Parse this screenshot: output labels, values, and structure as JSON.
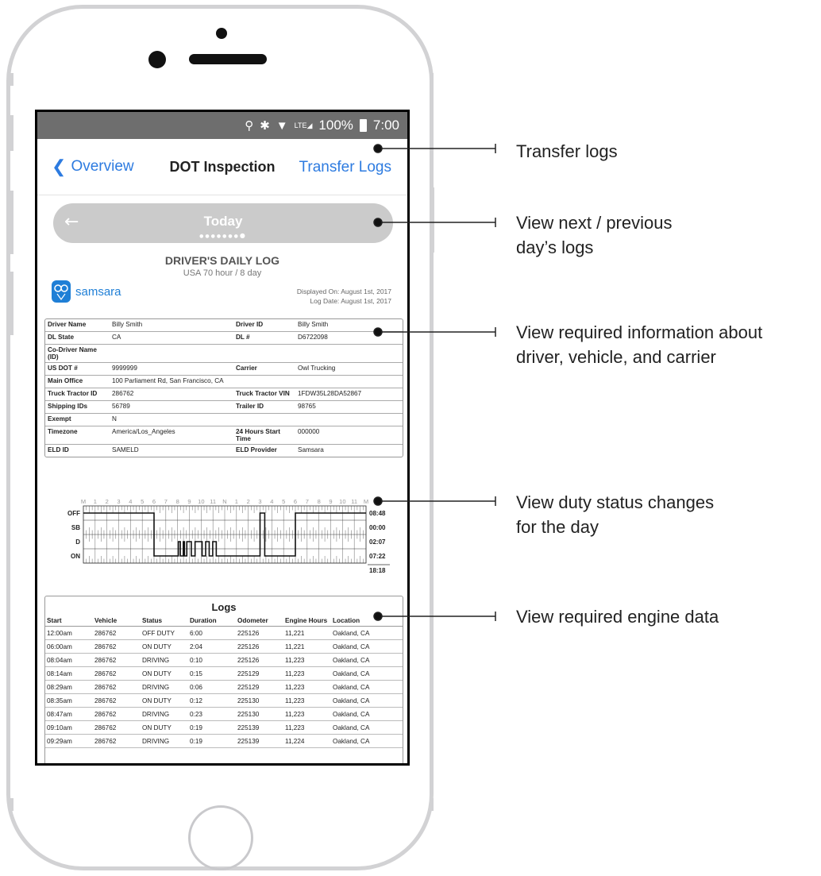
{
  "status_bar": {
    "battery": "100%",
    "time": "7:00",
    "network": "LTE"
  },
  "nav": {
    "back_label": "Overview",
    "title": "DOT Inspection",
    "action_label": "Transfer Logs"
  },
  "day_nav": {
    "label": "Today"
  },
  "report": {
    "title": "DRIVER'S DAILY LOG",
    "subtitle": "USA 70 hour / 8 day",
    "brand": "samsara",
    "displayed_on": "Displayed On: August 1st, 2017",
    "log_date": "Log Date: August 1st, 2017"
  },
  "info": {
    "driver_name_k": "Driver Name",
    "driver_name_v": "Billy Smith",
    "driver_id_k": "Driver ID",
    "driver_id_v": "Billy Smith",
    "dl_state_k": "DL State",
    "dl_state_v": "CA",
    "dl_num_k": "DL #",
    "dl_num_v": "D6722098",
    "codriver_k": "Co-Driver Name (ID)",
    "usdot_k": "US DOT #",
    "usdot_v": "9999999",
    "carrier_k": "Carrier",
    "carrier_v": "Owl Trucking",
    "office_k": "Main Office",
    "office_v": "100 Parliament Rd, San Francisco, CA",
    "tractor_k": "Truck Tractor ID",
    "tractor_v": "286762",
    "vin_k": "Truck Tractor VIN",
    "vin_v": "1FDW35L28DA52867",
    "shipping_k": "Shipping IDs",
    "shipping_v": "56789",
    "trailer_k": "Trailer ID",
    "trailer_v": "98765",
    "exempt_k": "Exempt",
    "exempt_v": "N",
    "tz_k": "Timezone",
    "tz_v": "America/Los_Angeles",
    "start_k": "24 Hours Start Time",
    "start_v": "000000",
    "eld_k": "ELD ID",
    "eld_v": "SAMELD",
    "provider_k": "ELD Provider",
    "provider_v": "Samsara"
  },
  "duty_grid": {
    "hour_labels": [
      "M",
      "1",
      "2",
      "3",
      "4",
      "5",
      "6",
      "7",
      "8",
      "9",
      "10",
      "11",
      "N",
      "1",
      "2",
      "3",
      "4",
      "5",
      "6",
      "7",
      "8",
      "9",
      "10",
      "11",
      "M"
    ],
    "rows": [
      "OFF",
      "SB",
      "D",
      "ON"
    ],
    "totals": [
      "08:48",
      "00:00",
      "02:07",
      "07:22"
    ],
    "grand_total": "18:18"
  },
  "logs": {
    "title": "Logs",
    "columns": [
      "Start",
      "Vehicle",
      "Status",
      "Duration",
      "Odometer",
      "Engine Hours",
      "Location"
    ],
    "rows": [
      [
        "12:00am",
        "286762",
        "OFF DUTY",
        "6:00",
        "225126",
        "11,221",
        "Oakland, CA"
      ],
      [
        "06:00am",
        "286762",
        "ON DUTY",
        "2:04",
        "225126",
        "11,221",
        "Oakland, CA"
      ],
      [
        "08:04am",
        "286762",
        "DRIVING",
        "0:10",
        "225126",
        "11,223",
        "Oakland, CA"
      ],
      [
        "08:14am",
        "286762",
        "ON DUTY",
        "0:15",
        "225129",
        "11,223",
        "Oakland, CA"
      ],
      [
        "08:29am",
        "286762",
        "DRIVING",
        "0:06",
        "225129",
        "11,223",
        "Oakland, CA"
      ],
      [
        "08:35am",
        "286762",
        "ON DUTY",
        "0:12",
        "225130",
        "11,223",
        "Oakland, CA"
      ],
      [
        "08:47am",
        "286762",
        "DRIVING",
        "0:23",
        "225130",
        "11,223",
        "Oakland, CA"
      ],
      [
        "09:10am",
        "286762",
        "ON DUTY",
        "0:19",
        "225139",
        "11,223",
        "Oakland, CA"
      ],
      [
        "09:29am",
        "286762",
        "DRIVING",
        "0:19",
        "225139",
        "11,224",
        "Oakland, CA"
      ]
    ]
  },
  "callouts": {
    "transfer": "Transfer logs",
    "day_nav_1": "View next / previous",
    "day_nav_2": "day’s logs",
    "info_1": "View required information about",
    "info_2": "driver, vehicle, and carrier",
    "duty_1": "View duty status changes",
    "duty_2": "for the day",
    "engine": "View required engine data"
  }
}
